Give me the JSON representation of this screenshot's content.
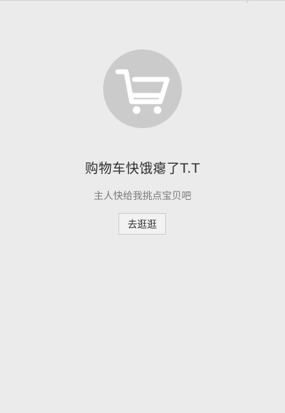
{
  "empty_state": {
    "icon": "cart-icon",
    "title": "购物车快饿瘪了T.T",
    "subtitle": "主人快给我挑点宝贝吧",
    "button_label": "去逛逛"
  },
  "colors": {
    "background": "#ebebeb",
    "icon_circle": "#cbcbcb",
    "icon_stroke": "#ffffff",
    "title": "#2f2f2f",
    "subtitle": "#7a7a7a",
    "button_border": "#c9c9c9"
  }
}
